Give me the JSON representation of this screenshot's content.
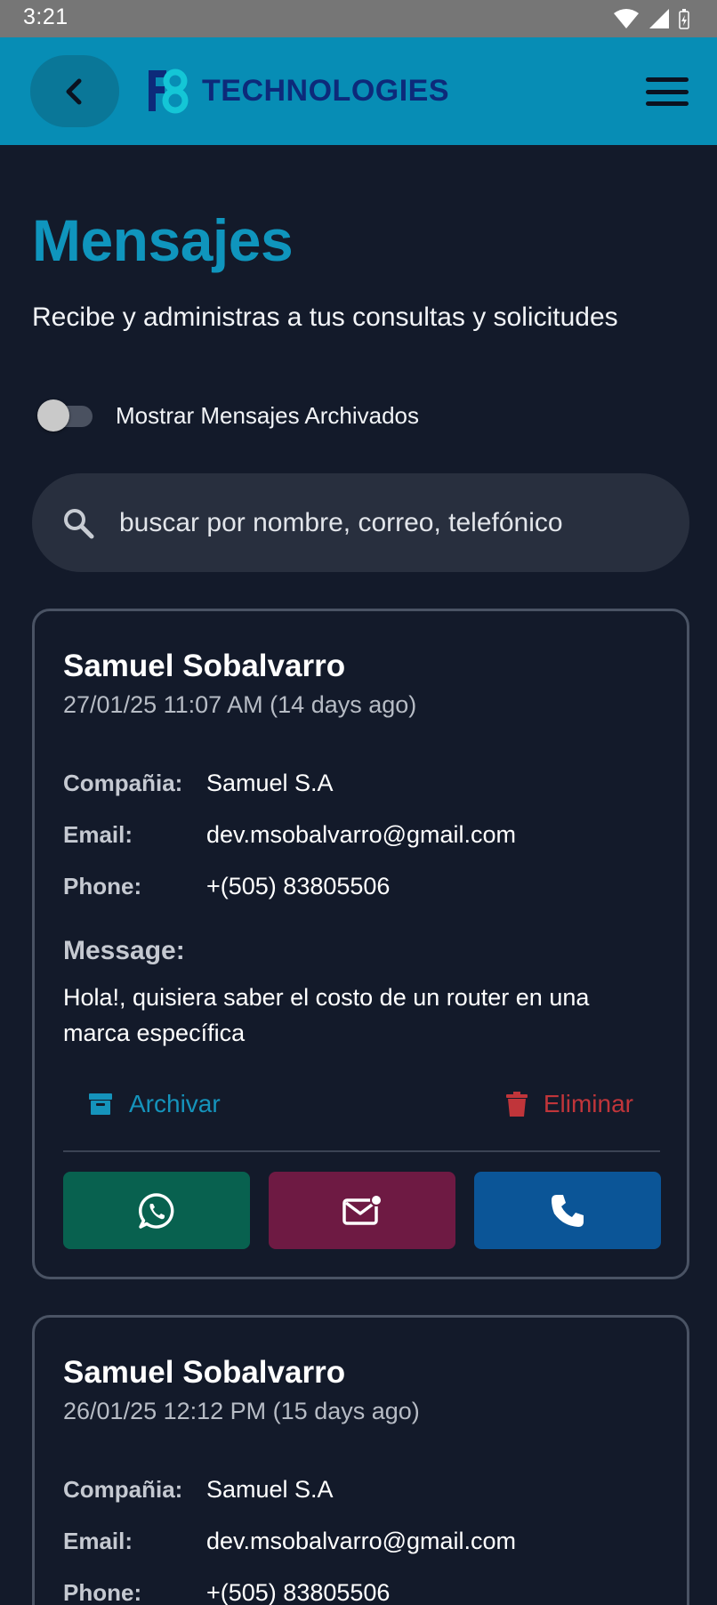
{
  "status_bar": {
    "time": "3:21"
  },
  "header": {
    "brand_name": "TECHNOLOGIES",
    "logo_mark": "F8"
  },
  "page": {
    "title": "Mensajes",
    "subtitle": "Recibe y administras a tus consultas y solicitudes"
  },
  "toggle": {
    "label": "Mostrar Mensajes Archivados",
    "checked": false
  },
  "search": {
    "placeholder": "buscar por nombre, correo, telefónico",
    "value": ""
  },
  "labels": {
    "company": "Compañia:",
    "email": "Email:",
    "phone": "Phone:",
    "message": "Message:",
    "archive": "Archivar",
    "delete": "Eliminar"
  },
  "messages": [
    {
      "name": "Samuel Sobalvarro",
      "date": "27/01/25 11:07 AM (14 days ago)",
      "company": "Samuel S.A",
      "email": "dev.msobalvarro@gmail.com",
      "phone": "+(505) 83805506",
      "message": "Hola!, quisiera saber el costo de un router en una marca específica"
    },
    {
      "name": "Samuel Sobalvarro",
      "date": "26/01/25 12:12 PM (15 days ago)",
      "company": "Samuel S.A",
      "email": "dev.msobalvarro@gmail.com",
      "phone": "+(505) 83805506"
    }
  ],
  "colors": {
    "background": "#131a2a",
    "header": "#078db5",
    "accent": "#0f95bd",
    "archive": "#1593bb",
    "delete": "#c0353a",
    "whatsapp": "#08614f",
    "email": "#6e1a43",
    "call": "#0b5597"
  },
  "icons": [
    "wifi-icon",
    "signal-icon",
    "battery-icon",
    "back-arrow-icon",
    "menu-icon",
    "search-icon",
    "archive-icon",
    "trash-icon",
    "whatsapp-icon",
    "mail-icon",
    "phone-icon"
  ]
}
